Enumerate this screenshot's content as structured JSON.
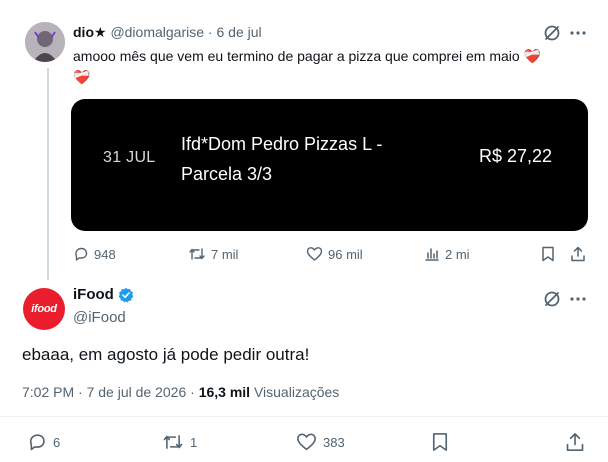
{
  "tweet1": {
    "author_name": "dio★",
    "author_handle": "@diomalgarise",
    "separator": "·",
    "date": "6 de jul",
    "text": "amooo mês que vem eu termino de pagar a pizza que comprei em maio",
    "emoji": "❤️‍🩹",
    "card": {
      "date": "31 JUL",
      "merchant": "Ifd*Dom Pedro Pizzas L - Parcela 3/3",
      "amount": "R$ 27,22"
    },
    "actions": {
      "replies": "948",
      "reposts": "7 mil",
      "likes": "96 mil",
      "views": "2 mi"
    }
  },
  "tweet2": {
    "author_name": "iFood",
    "author_handle": "@iFood",
    "avatar_text": "ifood",
    "text": "ebaaa, em agosto já pode pedir outra!",
    "meta": {
      "time": "7:02 PM",
      "separator": "·",
      "date": "7 de jul de 2026",
      "separator2": "·",
      "views_count": "16,3 mil",
      "views_label": "Visualizações"
    },
    "actions": {
      "replies": "6",
      "reposts": "1",
      "likes": "383"
    }
  },
  "colors": {
    "ifood_red": "#ea1d2c",
    "verified_blue": "#1d9bf0",
    "muted": "#536471"
  }
}
